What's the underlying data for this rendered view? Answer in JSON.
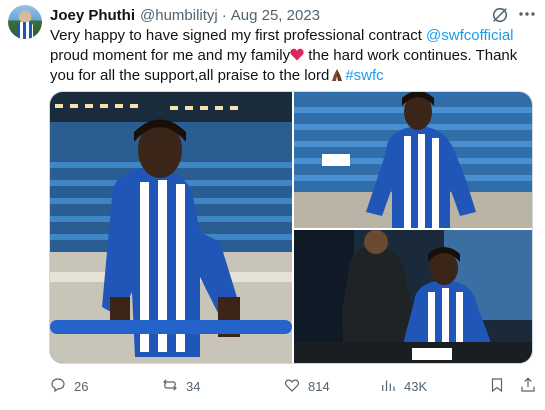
{
  "tweet": {
    "author_name": "Joey Phuthi",
    "author_handle": "@humbilityj",
    "separator": "·",
    "date": "Aug 25, 2023",
    "text_part1": "Very happy to have signed my first professional contract ",
    "mention": "@swfcofficial",
    "text_part2": " proud moment for me and my family",
    "text_part3": " the hard work continues. Thank you for all the support,all praise to the lord",
    "hashtag": "#swfc"
  },
  "icons": {
    "avatar": "profile-photo",
    "grok": "grok-icon",
    "more": "more-icon",
    "heart_emoji": "red-heart-emoji",
    "pray_emoji": "folded-hands-emoji",
    "reply": "reply-icon",
    "repost": "repost-icon",
    "like": "like-icon",
    "views": "views-icon",
    "bookmark": "bookmark-icon",
    "share": "share-icon"
  },
  "media": {
    "images": [
      {
        "name": "player-at-stadium-railing"
      },
      {
        "name": "player-in-stands"
      },
      {
        "name": "player-signing-contract"
      }
    ]
  },
  "actions": {
    "replies": "26",
    "reposts": "34",
    "likes": "814",
    "views": "43K"
  },
  "colors": {
    "link": "#1d9bf0",
    "secondary_text": "#536471",
    "kit_blue": "#1f56b8",
    "heart": "#e0245e"
  }
}
